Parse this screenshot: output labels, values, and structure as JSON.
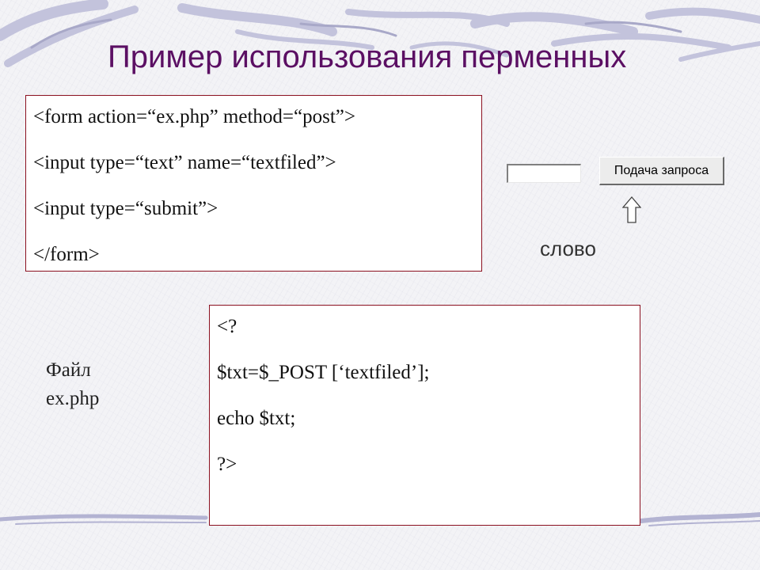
{
  "slide": {
    "title": "Пример использования перменных"
  },
  "html_code": {
    "lines": [
      "<form action=“ex.php” method=“post”>",
      "<input type=“text” name=“textfiled”>",
      "<input type=“submit”>",
      "</form>"
    ]
  },
  "form_demo": {
    "input_value": "",
    "button_label": "Подача запроса",
    "arrow_icon": "up-arrow-icon",
    "word_label": "слово"
  },
  "file_label": {
    "line1": "Файл",
    "line2": "ex.php"
  },
  "php_code": {
    "lines": [
      "<?",
      "$txt=$_POST [‘textfiled’];",
      "echo $txt;",
      "?>"
    ]
  },
  "colors": {
    "title": "#5b0f63",
    "box_border": "#8b1020",
    "swirl": "#b9b9d6"
  }
}
